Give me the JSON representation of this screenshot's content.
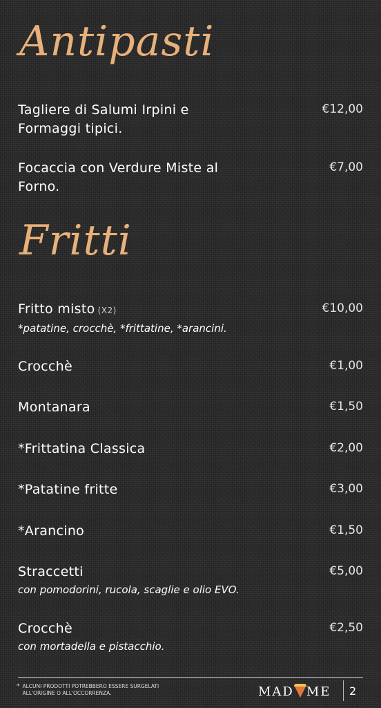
{
  "sections": [
    {
      "title": "Antipasti",
      "items": [
        {
          "name": "Tagliere di Salumi Irpini e Formaggi tipici.",
          "price": "€12,00"
        },
        {
          "name": "Focaccia con Verdure Miste al Forno.",
          "price": "€7,00"
        }
      ]
    },
    {
      "title": "Fritti",
      "items": [
        {
          "name": "Fritto misto",
          "qty": "(X2)",
          "desc": "*patatine, crocchè, *frittatine, *arancini.",
          "price": "€10,00"
        },
        {
          "name": "Crocchè",
          "price": "€1,00"
        },
        {
          "name": "Montanara",
          "price": "€1,50"
        },
        {
          "name": "*Frittatina Classica",
          "price": "€2,00"
        },
        {
          "name": "*Patatine fritte",
          "price": "€3,00"
        },
        {
          "name": "*Arancino",
          "price": "€1,50"
        },
        {
          "name": "Straccetti",
          "desc": "con pomodorini, rucola, scaglie e olio EVO.",
          "price": "€5,00"
        },
        {
          "name": "Crocchè",
          "desc": "con mortadella e pistacchio.",
          "price": "€2,50"
        }
      ]
    }
  ],
  "footer": {
    "note_star": "*",
    "note": "ALCUNI PRODOTTI POTREBBERO ESSERE SURGELATI ALL'ORIGINE O ALL'OCCORRENZA.",
    "brand_left": "MAD",
    "brand_right": "ME",
    "brand_icon": "pizza-slice-icon",
    "page_number": "2"
  },
  "colors": {
    "background": "#2a2a2a",
    "heading": "#e8b07a",
    "text": "#ffffff",
    "brand_accent": "#e0783a"
  }
}
